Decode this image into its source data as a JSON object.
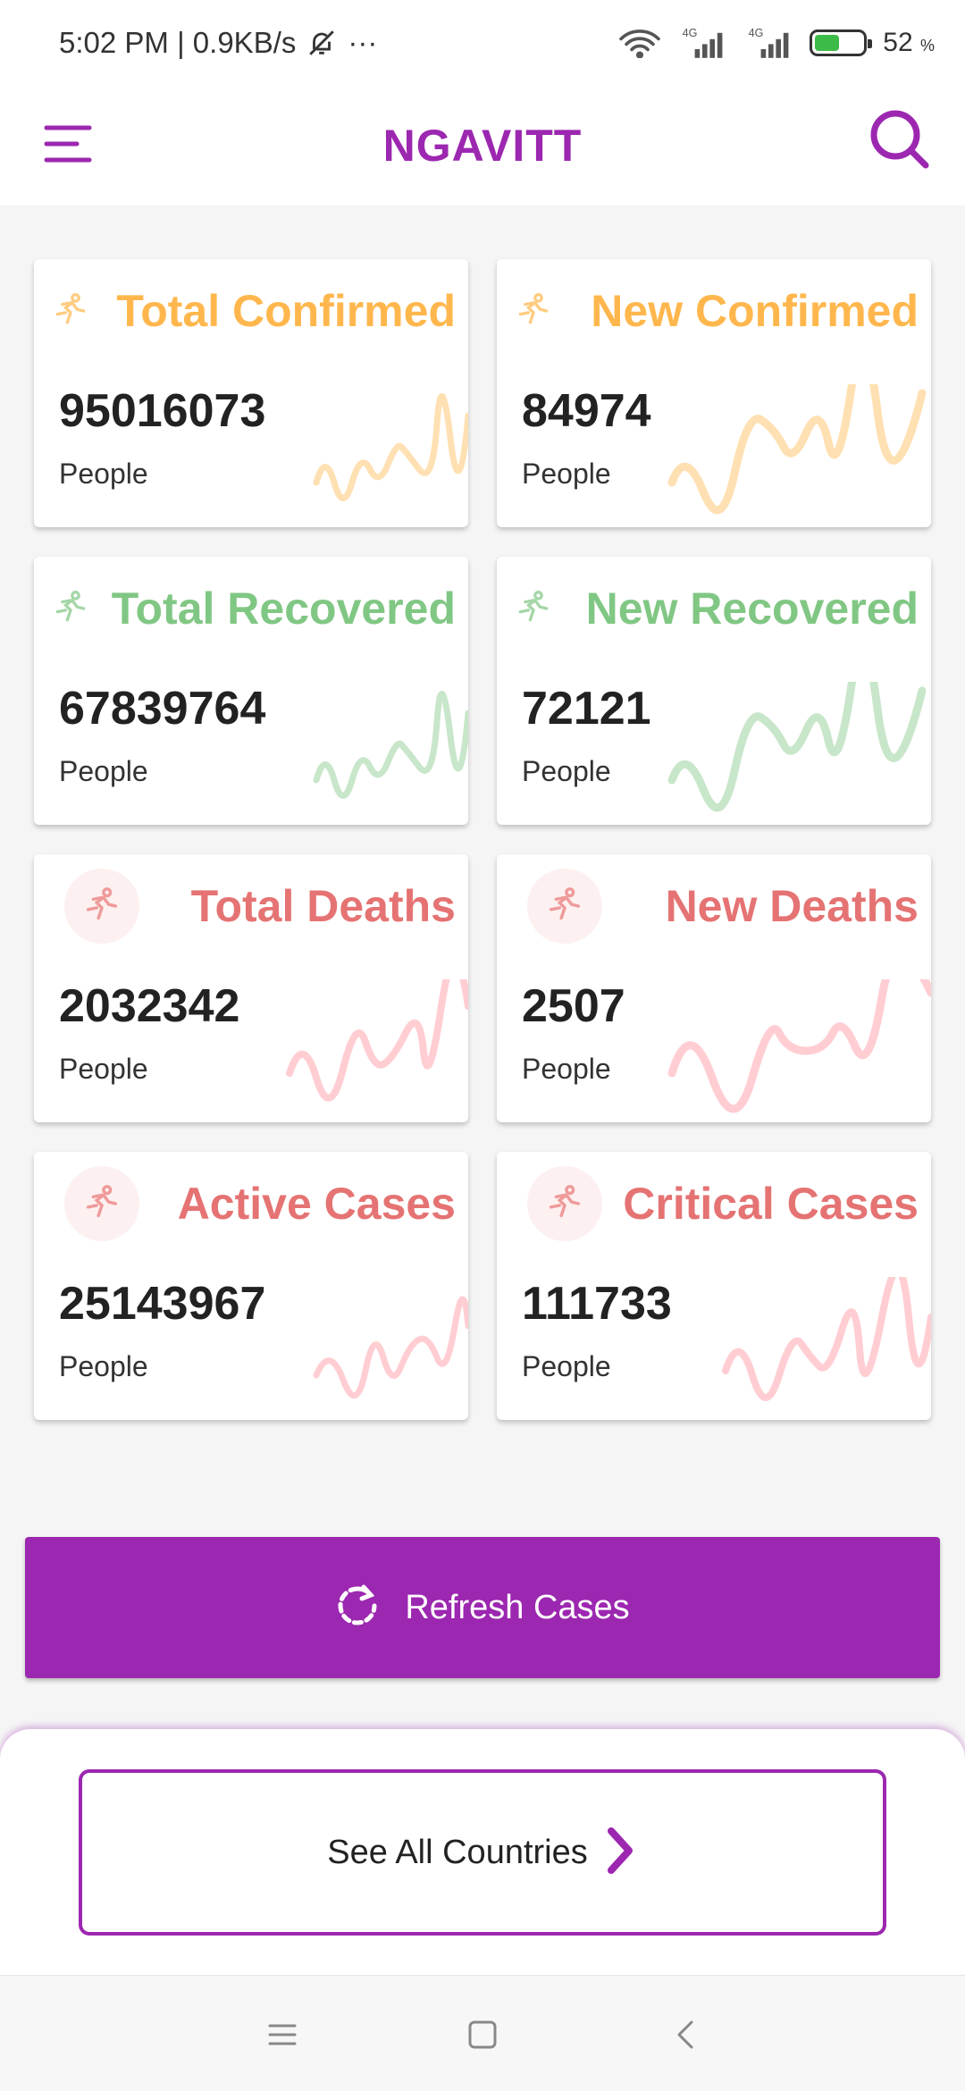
{
  "status_bar": {
    "time_speed": "5:02 PM | 0.9KB/s",
    "more": "···",
    "signal1_label": "4G",
    "signal2_label": "4G",
    "battery_percent": "52",
    "battery_unit": "%",
    "battery_level": 0.52
  },
  "app_bar": {
    "title": "NGAVITT",
    "menu_icon": "hamburger-menu-icon",
    "search_icon": "search-icon"
  },
  "colors": {
    "primary": "#9c27b0",
    "confirmed": "#ffb74d",
    "recovered": "#81c784",
    "deaths": "#e57373"
  },
  "cards": [
    {
      "title": "Total Confirmed",
      "value": "95016073",
      "unit": "People",
      "icon": "running-person-icon"
    },
    {
      "title": "New Confirmed",
      "value": "84974",
      "unit": "People",
      "icon": "running-person-icon"
    },
    {
      "title": "Total Recovered",
      "value": "67839764",
      "unit": "People",
      "icon": "running-person-icon"
    },
    {
      "title": "New Recovered",
      "value": "72121",
      "unit": "People",
      "icon": "running-person-icon"
    },
    {
      "title": "Total Deaths",
      "value": "2032342",
      "unit": "People",
      "icon": "running-person-icon"
    },
    {
      "title": "New Deaths",
      "value": "2507",
      "unit": "People",
      "icon": "running-person-icon"
    },
    {
      "title": "Active Cases",
      "value": "25143967",
      "unit": "People",
      "icon": "running-person-icon"
    },
    {
      "title": "Critical Cases",
      "value": "111733",
      "unit": "People",
      "icon": "running-person-icon"
    }
  ],
  "refresh": {
    "label": "Refresh Cases",
    "icon": "refresh-icon"
  },
  "countries": {
    "label": "See All Countries",
    "icon": "chevron-right-icon"
  },
  "nav": {
    "recents_icon": "recents-icon",
    "home_icon": "home-icon",
    "back_icon": "back-icon"
  }
}
